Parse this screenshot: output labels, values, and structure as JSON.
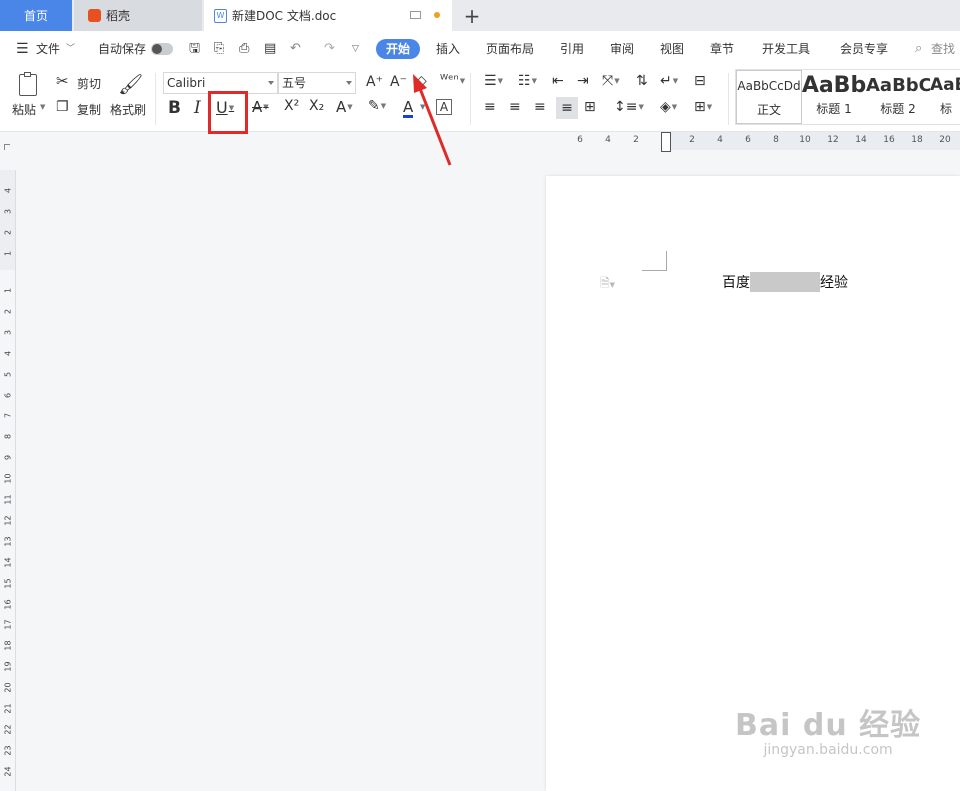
{
  "tabs": {
    "home": "首页",
    "docer": "稻壳",
    "doc": "新建DOC 文档.doc",
    "add": "+"
  },
  "menu": {
    "file": "文件",
    "autosave": "自动保存",
    "items": [
      "开始",
      "插入",
      "页面布局",
      "引用",
      "审阅",
      "视图",
      "章节",
      "开发工具",
      "会员专享"
    ],
    "search": "查找命"
  },
  "ribbon": {
    "paste": "粘贴",
    "cut": "剪切",
    "copy": "复制",
    "format_painter": "格式刷",
    "font_name": "Calibri",
    "font_size": "五号",
    "styles": [
      {
        "sample": "AaBbCcDd",
        "name": "正文"
      },
      {
        "sample": "AaBb",
        "name": "标题 1"
      },
      {
        "sample": "AaBbC",
        "name": "标题 2"
      },
      {
        "sample": "AaB",
        "name": "标"
      }
    ]
  },
  "ruler": {
    "h_ticks": [
      "6",
      "4",
      "2",
      "2",
      "4",
      "6",
      "8",
      "10",
      "12",
      "14",
      "16",
      "18",
      "20"
    ],
    "v_top": [
      "4",
      "3",
      "2",
      "1"
    ],
    "v_main": [
      "1",
      "2",
      "3",
      "4",
      "5",
      "6",
      "7",
      "8",
      "9",
      "10",
      "11",
      "12",
      "13",
      "14",
      "15",
      "16",
      "17",
      "18",
      "19",
      "20",
      "21",
      "22",
      "23",
      "24"
    ]
  },
  "document": {
    "text_before": "百度",
    "text_after": "经验"
  },
  "watermark": {
    "brand": "Bai du 经验",
    "url": "jingyan.baidu.com"
  },
  "colors": {
    "accent": "#4a86e8",
    "highlight_box": "#e02a2a",
    "arrow": "#e02a2a"
  }
}
